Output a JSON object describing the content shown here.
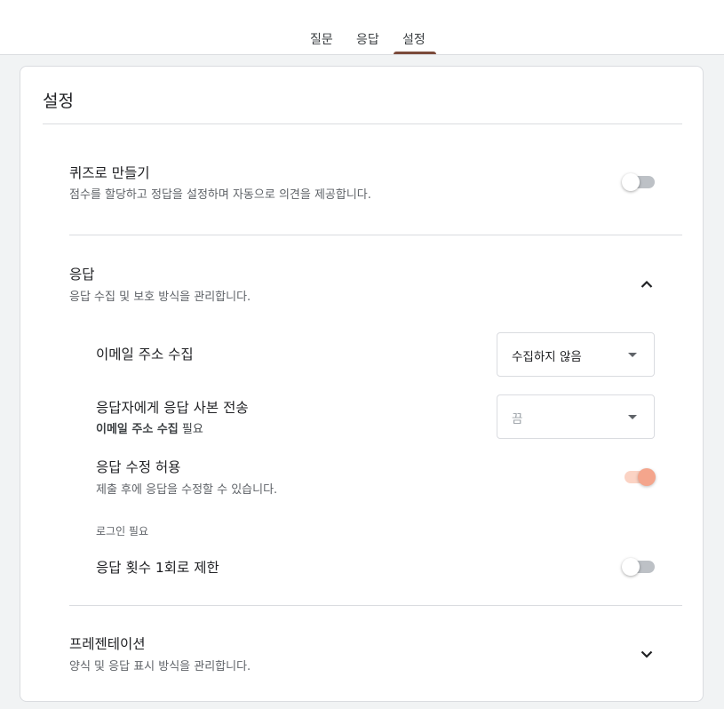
{
  "tabs": {
    "questions": "질문",
    "responses": "응답",
    "settings": "설정"
  },
  "card": {
    "title": "설정"
  },
  "quiz": {
    "title": "퀴즈로 만들기",
    "subtitle": "점수를 할당하고 정답을 설정하며 자동으로 의견을 제공합니다.",
    "enabled": false
  },
  "responses_section": {
    "title": "응답",
    "subtitle": "응답 수집 및 보호 방식을 관리합니다.",
    "expanded": true,
    "collect_email": {
      "label": "이메일 주소 수집",
      "selected": "수집하지 않음"
    },
    "send_copy": {
      "label": "응답자에게 응답 사본 전송",
      "note_bold": "이메일 주소 수집",
      "note_rest": " 필요",
      "selected": "끔"
    },
    "allow_edit": {
      "label": "응답 수정 허용",
      "subtitle": "제출 후에 응답을 수정할 수 있습니다.",
      "enabled": true
    },
    "login_required_label": "로그인 필요",
    "limit_one": {
      "label": "응답 횟수 1회로 제한",
      "enabled": false
    }
  },
  "presentation_section": {
    "title": "프레젠테이션",
    "subtitle": "양식 및 응답 표시 방식을 관리합니다.",
    "expanded": false
  },
  "colors": {
    "accent_tab": "#7b4a3a",
    "toggle_on_thumb": "#f4a58c",
    "toggle_on_track": "#fbd3c4",
    "toggle_off_track": "#bdc1c6"
  }
}
